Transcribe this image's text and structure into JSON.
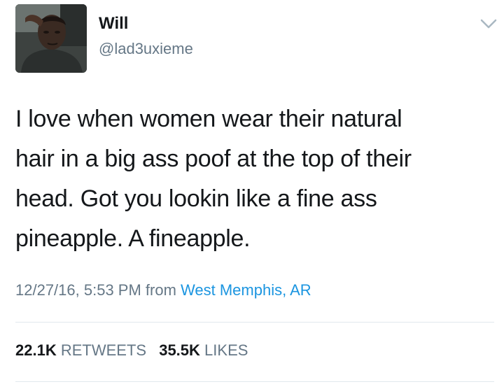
{
  "tweet": {
    "author_name": "Will",
    "author_handle": "@lad3uxieme",
    "text_lines": [
      "I love when women wear their natural",
      "hair in a big ass poof at the top of their",
      "head. Got you lookin like a fine ass",
      "pineapple. A fineapple."
    ],
    "timestamp": "12/27/16, 5:53 PM from",
    "location": "West Memphis, AR",
    "retweets_count": "22.1K",
    "retweets_label": "RETWEETS",
    "likes_count": "35.5K",
    "likes_label": "LIKES"
  },
  "icons": {
    "menu": "chevron-down-icon",
    "avatar": "avatar"
  },
  "colors": {
    "text": "#14171a",
    "secondary": "#657786",
    "link": "#1b95e0",
    "divider": "#e1e8ed"
  }
}
